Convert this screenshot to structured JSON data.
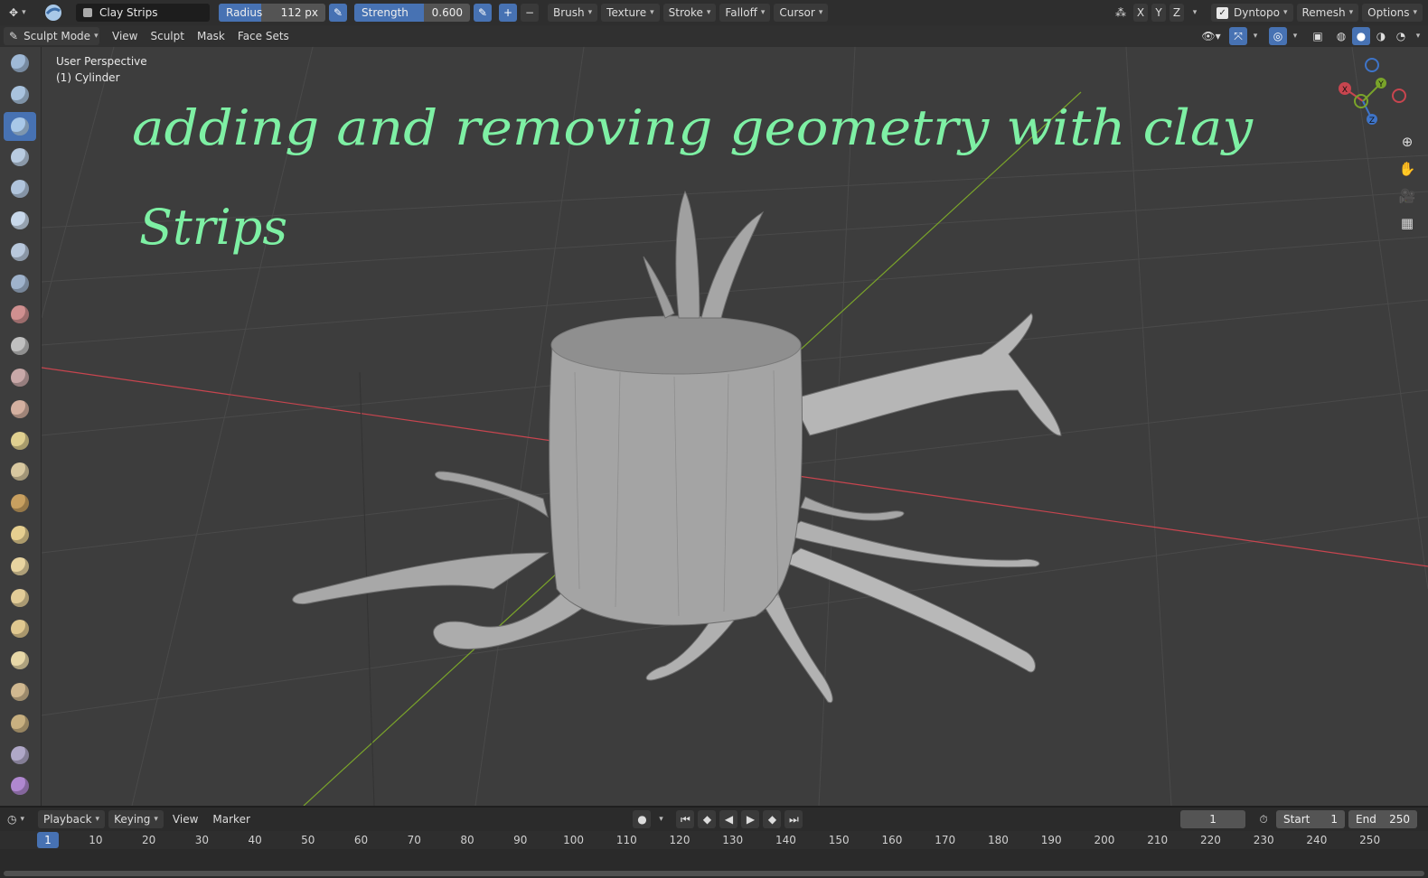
{
  "header": {
    "brush_name": "Clay Strips",
    "radius_label": "Radius",
    "radius_value": "112 px",
    "strength_label": "Strength",
    "strength_value": "0.600",
    "strength_fraction": 0.6,
    "menus": [
      "Brush",
      "Texture",
      "Stroke",
      "Falloff",
      "Cursor"
    ],
    "axes": [
      "X",
      "Y",
      "Z"
    ],
    "dyntopo_label": "Dyntopo",
    "remesh_label": "Remesh",
    "options_label": "Options"
  },
  "modebar": {
    "mode_label": "Sculpt Mode",
    "menus": [
      "View",
      "Sculpt",
      "Mask",
      "Face Sets"
    ]
  },
  "viewport": {
    "view_name": "User Perspective",
    "object_name": "(1) Cylinder",
    "annotation_line1": "adding and removing geometry with clay",
    "annotation_line2": "Strips",
    "gizmo_labels": [
      "X",
      "Y",
      "Z"
    ]
  },
  "tools": {
    "count": 24,
    "active_index": 2,
    "icon_names": [
      "draw",
      "draw-sharp",
      "clay",
      "clay-strips",
      "clay-thumb",
      "layer",
      "inflate",
      "blob",
      "crease",
      "smooth",
      "flatten",
      "fill",
      "scrape",
      "multiplane-scrape",
      "pinch",
      "grab",
      "elastic-deform",
      "snake-hook",
      "thumb",
      "pose",
      "nudge",
      "rotate",
      "slide-relax",
      "boundary"
    ]
  },
  "timeline": {
    "menus": [
      "Playback",
      "Keying",
      "View",
      "Marker"
    ],
    "current_frame": "1",
    "start_label": "Start",
    "start_value": "1",
    "end_label": "End",
    "end_value": "250",
    "ticks": [
      "10",
      "20",
      "30",
      "40",
      "50",
      "60",
      "70",
      "80",
      "90",
      "100",
      "110",
      "120",
      "130",
      "140",
      "150",
      "160",
      "170",
      "180",
      "190",
      "200",
      "210",
      "220",
      "230",
      "240",
      "250"
    ],
    "playhead_label": "1"
  },
  "colors": {
    "accent": "#4772b3",
    "annotation": "#7ef0a4",
    "x_axis": "#c8454f",
    "y_axis": "#7aa42a",
    "z_axis": "#3e74c8"
  }
}
